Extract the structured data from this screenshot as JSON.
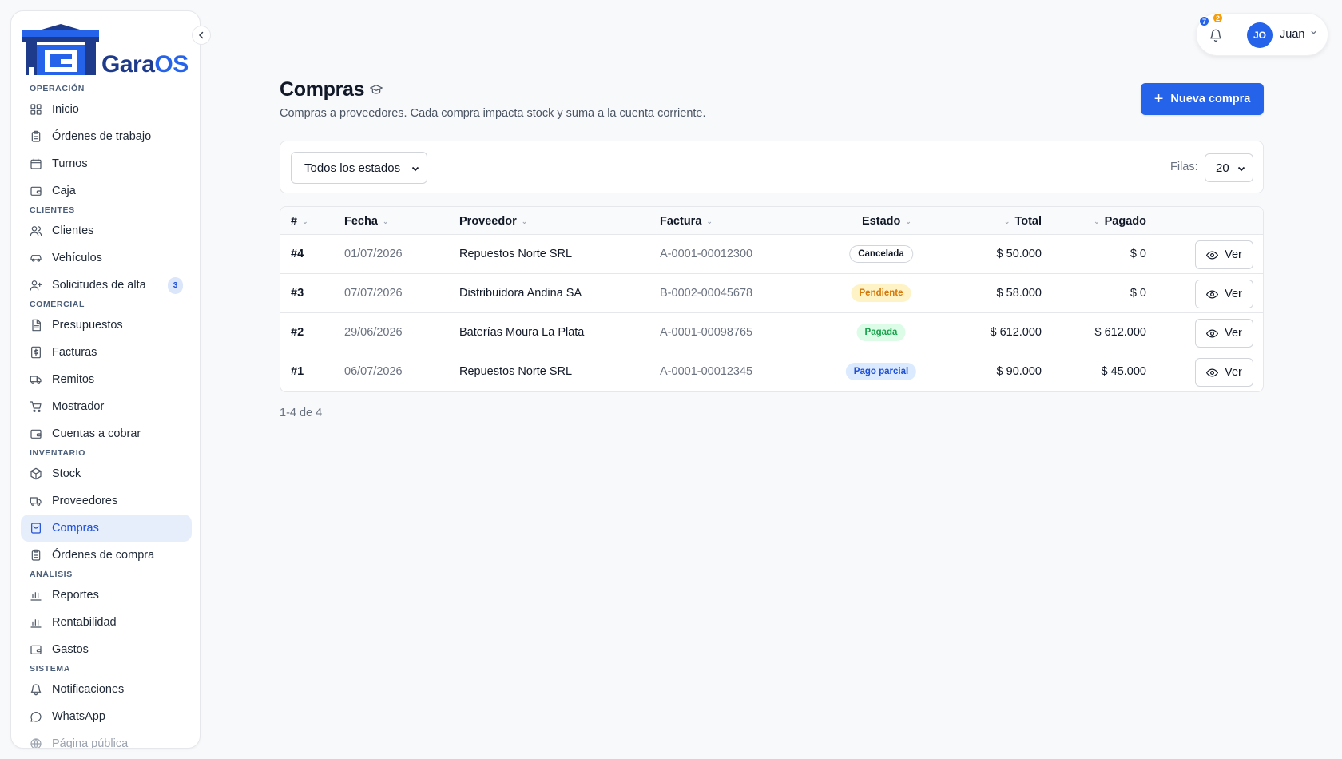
{
  "app": {
    "logo_prefix": "Gara",
    "logo_suffix": "OS"
  },
  "sidebar": {
    "sections": [
      {
        "title": "OPERACIÓN",
        "items": [
          {
            "label": "Inicio",
            "icon": "grid-icon"
          },
          {
            "label": "Órdenes de trabajo",
            "icon": "clipboard-icon"
          },
          {
            "label": "Turnos",
            "icon": "calendar-icon"
          },
          {
            "label": "Caja",
            "icon": "wallet-icon"
          }
        ]
      },
      {
        "title": "CLIENTES",
        "items": [
          {
            "label": "Clientes",
            "icon": "users-icon"
          },
          {
            "label": "Vehículos",
            "icon": "car-icon"
          },
          {
            "label": "Solicitudes de alta",
            "icon": "user-plus-icon",
            "badge": "3"
          }
        ]
      },
      {
        "title": "COMERCIAL",
        "items": [
          {
            "label": "Presupuestos",
            "icon": "document-icon"
          },
          {
            "label": "Facturas",
            "icon": "invoice-icon"
          },
          {
            "label": "Remitos",
            "icon": "truck-icon"
          },
          {
            "label": "Mostrador",
            "icon": "cart-icon"
          },
          {
            "label": "Cuentas a cobrar",
            "icon": "wallet-icon"
          }
        ]
      },
      {
        "title": "INVENTARIO",
        "items": [
          {
            "label": "Stock",
            "icon": "box-icon"
          },
          {
            "label": "Proveedores",
            "icon": "truck-icon"
          },
          {
            "label": "Compras",
            "icon": "shopping-bag-icon",
            "active": true
          },
          {
            "label": "Órdenes de compra",
            "icon": "clipboard-icon"
          }
        ]
      },
      {
        "title": "ANÁLISIS",
        "items": [
          {
            "label": "Reportes",
            "icon": "bar-chart-icon"
          },
          {
            "label": "Rentabilidad",
            "icon": "bar-chart-icon"
          },
          {
            "label": "Gastos",
            "icon": "wallet-icon"
          }
        ]
      },
      {
        "title": "SISTEMA",
        "items": [
          {
            "label": "Notificaciones",
            "icon": "bell-icon"
          },
          {
            "label": "WhatsApp",
            "icon": "chat-icon"
          },
          {
            "label": "Página pública",
            "icon": "globe-icon",
            "faded": true
          }
        ]
      }
    ]
  },
  "topbar": {
    "notif_count_blue": "7",
    "notif_count_orange": "2",
    "avatar_initials": "JO",
    "user_name": "Juan"
  },
  "header": {
    "title": "Compras",
    "subtitle": "Compras a proveedores. Cada compra impacta stock y suma a la cuenta corriente.",
    "new_button": "Nueva compra"
  },
  "filters": {
    "status_selected": "Todos los estados",
    "rows_label": "Filas:",
    "rows_selected": "20"
  },
  "table": {
    "headers": {
      "id": "#",
      "fecha": "Fecha",
      "proveedor": "Proveedor",
      "factura": "Factura",
      "estado": "Estado",
      "total": "Total",
      "pagado": "Pagado"
    },
    "view_label": "Ver",
    "rows": [
      {
        "id": "#4",
        "fecha": "01/07/2026",
        "proveedor": "Repuestos Norte SRL",
        "factura": "A-0001-00012300",
        "estado": "Cancelada",
        "estado_kind": "cancel",
        "total": "$ 50.000",
        "pagado": "$ 0"
      },
      {
        "id": "#3",
        "fecha": "07/07/2026",
        "proveedor": "Distribuidora Andina SA",
        "factura": "B-0002-00045678",
        "estado": "Pendiente",
        "estado_kind": "pend",
        "total": "$ 58.000",
        "pagado": "$ 0"
      },
      {
        "id": "#2",
        "fecha": "29/06/2026",
        "proveedor": "Baterías Moura La Plata",
        "factura": "A-0001-00098765",
        "estado": "Pagada",
        "estado_kind": "paid",
        "total": "$ 612.000",
        "pagado": "$ 612.000"
      },
      {
        "id": "#1",
        "fecha": "06/07/2026",
        "proveedor": "Repuestos Norte SRL",
        "factura": "A-0001-00012345",
        "estado": "Pago parcial",
        "estado_kind": "part",
        "total": "$ 90.000",
        "pagado": "$ 45.000"
      }
    ]
  },
  "pager": {
    "text": "1-4 de 4"
  },
  "colors": {
    "accent": "#2563eb",
    "logo_dark": "#1e3a8a"
  }
}
